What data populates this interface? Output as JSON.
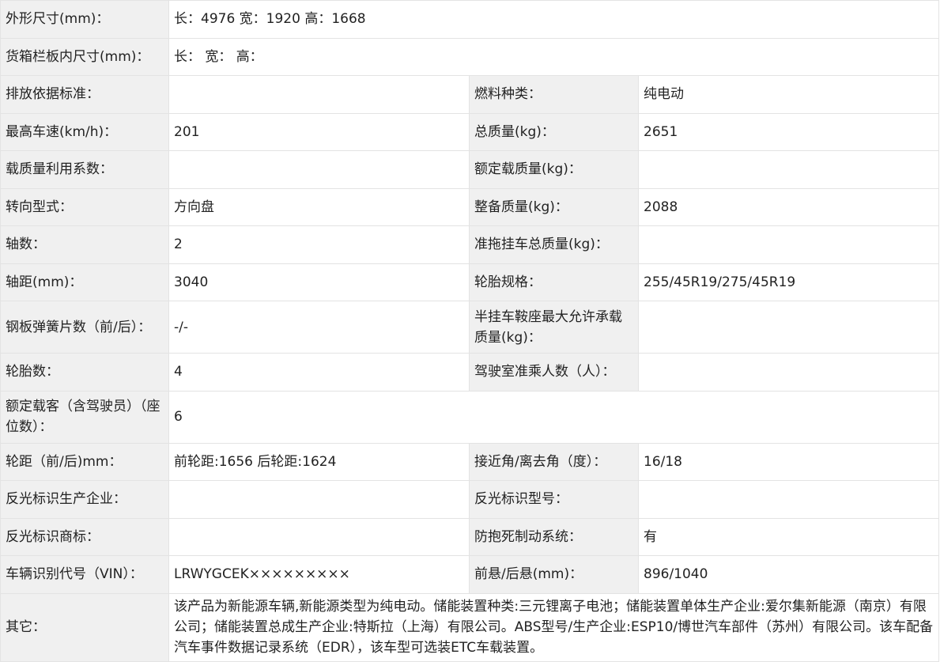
{
  "rows": [
    {
      "label": "外形尺寸(mm)：",
      "value": "长：4976 宽：1920 高：1668"
    },
    {
      "label": "货箱栏板内尺寸(mm)：",
      "value": "长： 宽： 高："
    },
    {
      "label": "排放依据标准：",
      "value": "",
      "label2": "燃料种类：",
      "value2": "纯电动"
    },
    {
      "label": "最高车速(km/h)：",
      "value": "201",
      "label2": "总质量(kg)：",
      "value2": "2651"
    },
    {
      "label": "载质量利用系数：",
      "value": "",
      "label2": "额定载质量(kg)：",
      "value2": ""
    },
    {
      "label": "转向型式：",
      "value": "方向盘",
      "label2": "整备质量(kg)：",
      "value2": "2088"
    },
    {
      "label": "轴数：",
      "value": "2",
      "label2": "准拖挂车总质量(kg)：",
      "value2": ""
    },
    {
      "label": "轴距(mm)：",
      "value": "3040",
      "label2": "轮胎规格：",
      "value2": "255/45R19/275/45R19"
    },
    {
      "label": "钢板弹簧片数（前/后）：",
      "value": "-/-",
      "label2": "半挂车鞍座最大允许承载质量(kg)：",
      "value2": ""
    },
    {
      "label": "轮胎数：",
      "value": "4",
      "label2": "驾驶室准乘人数（人）：",
      "value2": ""
    },
    {
      "label": "额定载客（含驾驶员）（座位数）：",
      "value": "6"
    },
    {
      "label": "轮距（前/后)mm：",
      "value": "前轮距:1656 后轮距:1624",
      "label2": "接近角/离去角（度）：",
      "value2": "16/18"
    },
    {
      "label": "反光标识生产企业：",
      "value": "",
      "label2": "反光标识型号：",
      "value2": ""
    },
    {
      "label": "反光标识商标：",
      "value": "",
      "label2": "防抱死制动系统：",
      "value2": "有"
    },
    {
      "label": "车辆识别代号（VIN）：",
      "value": "LRWYGCEK×××××××××",
      "label2": "前悬/后悬(mm)：",
      "value2": "896/1040"
    },
    {
      "label": "其它：",
      "value": "该产品为新能源车辆,新能源类型为纯电动。储能装置种类:三元锂离子电池；储能装置单体生产企业:爱尔集新能源（南京）有限公司；储能装置总成生产企业:特斯拉（上海）有限公司。ABS型号/生产企业:ESP10/博世汽车部件（苏州）有限公司。该车配备汽车事件数据记录系统（EDR），该车型可选装ETC车载装置。"
    }
  ]
}
